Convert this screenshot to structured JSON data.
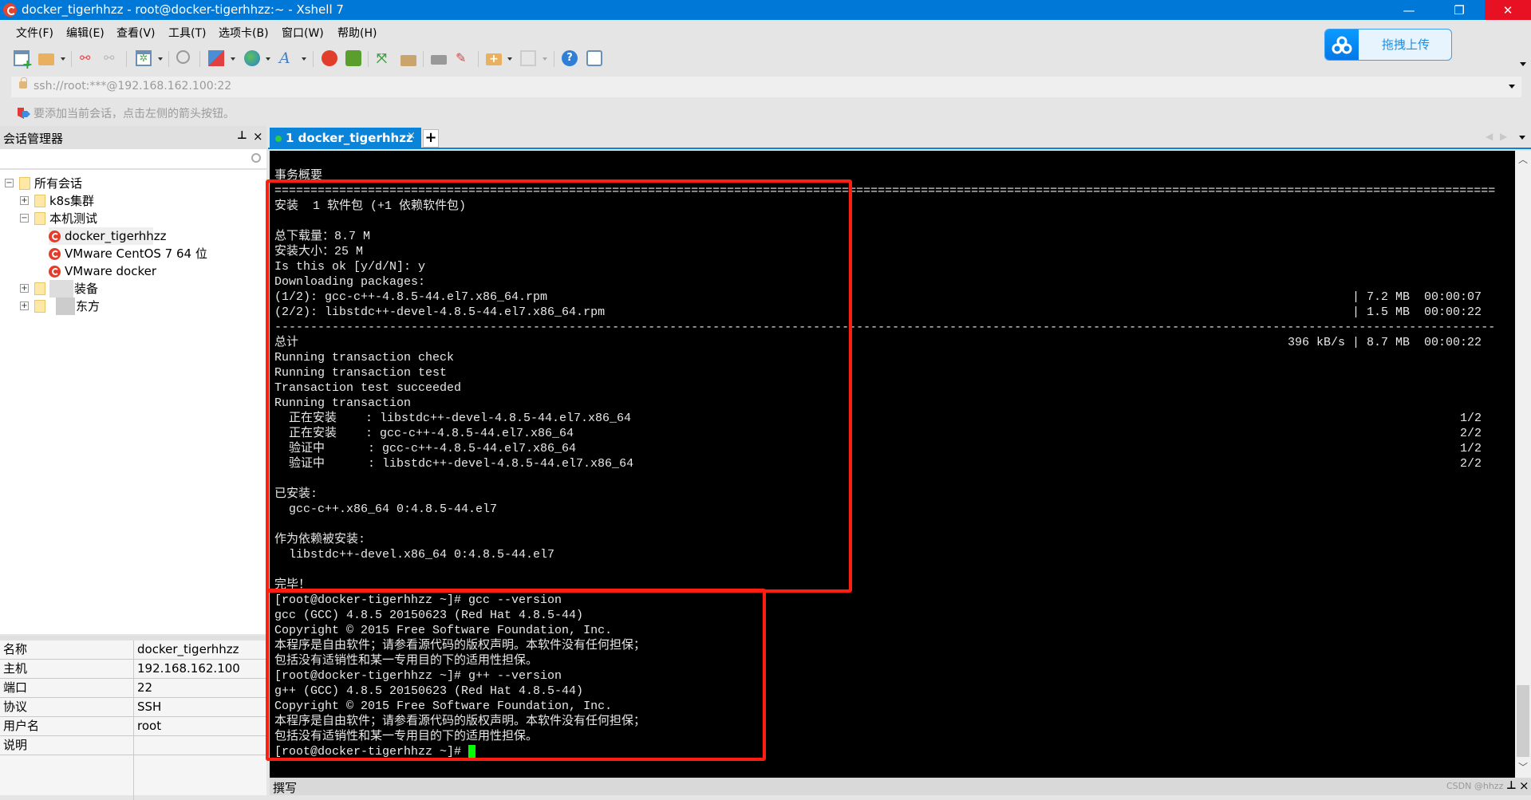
{
  "window": {
    "title": "docker_tigerhhzz - root@docker-tigerhhzz:~ - Xshell 7",
    "controls": {
      "minimize": "—",
      "restore": "❐",
      "close": "✕"
    }
  },
  "menu": [
    "文件(F)",
    "编辑(E)",
    "查看(V)",
    "工具(T)",
    "选项卡(B)",
    "窗口(W)",
    "帮助(H)"
  ],
  "toolbar": {
    "icons": [
      "new-session-icon",
      "open-folder-icon",
      "disconnect-icon",
      "reconnect-icon",
      "session-properties-icon",
      "find-icon",
      "transfer-icon",
      "globe-icon",
      "font-icon",
      "xshell-icon",
      "xftp-icon",
      "fullscreen-icon",
      "lock-icon",
      "keyboard-icon",
      "highlight-icon",
      "new-tab-group-icon",
      "layout-icon",
      "help-icon",
      "chat-icon"
    ],
    "upload_label": "拖拽上传"
  },
  "address": {
    "url": "ssh://root:***@192.168.162.100:22"
  },
  "hint": {
    "text": "要添加当前会话，点击左侧的箭头按钮。"
  },
  "session_manager": {
    "title": "会话管理器",
    "pin": "⊥",
    "close": "×",
    "search_placeholder": "",
    "tree": [
      {
        "label": "所有会话",
        "type": "root",
        "expanded": true
      },
      {
        "label": "k8s集群",
        "type": "folder",
        "expanded": false
      },
      {
        "label": "本机测试",
        "type": "folder",
        "expanded": true
      },
      {
        "label": "docker_tigerhhzz",
        "type": "session",
        "selected": true
      },
      {
        "label": "VMware CentOS 7 64 位",
        "type": "session"
      },
      {
        "label": "VMware docker",
        "type": "session"
      },
      {
        "label": "装备",
        "type": "folder",
        "expanded": false,
        "blurred_prefix": true
      },
      {
        "label": "东方",
        "type": "folder",
        "expanded": false,
        "blurred_prefix": true
      }
    ]
  },
  "properties": [
    {
      "key": "名称",
      "value": "docker_tigerhhzz"
    },
    {
      "key": "主机",
      "value": "192.168.162.100"
    },
    {
      "key": "端口",
      "value": "22"
    },
    {
      "key": "协议",
      "value": "SSH"
    },
    {
      "key": "用户名",
      "value": "root"
    },
    {
      "key": "说明",
      "value": ""
    }
  ],
  "tabs": [
    {
      "number": "1",
      "label": "1 docker_tigerhhzz",
      "active": true,
      "close": "×"
    }
  ],
  "tab_add": "+",
  "terminal": {
    "lines": [
      "事务概要",
      "==========================================================================================================================================================================",
      "安装  1 软件包 (+1 依赖软件包)",
      "",
      "总下载量：8.7 M",
      "安装大小：25 M",
      "Is this ok [y/d/N]: y",
      "Downloading packages:",
      "(1/2): gcc-c++-4.8.5-44.el7.x86_64.rpm",
      "(2/2): libstdc++-devel-4.8.5-44.el7.x86_64.rpm",
      "--------------------------------------------------------------------------------------------------------------------------------------------------------------------------",
      "总计",
      "Running transaction check",
      "Running transaction test",
      "Transaction test succeeded",
      "Running transaction",
      "  正在安装    : libstdc++-devel-4.8.5-44.el7.x86_64",
      "  正在安装    : gcc-c++-4.8.5-44.el7.x86_64",
      "  验证中      : gcc-c++-4.8.5-44.el7.x86_64",
      "  验证中      : libstdc++-devel-4.8.5-44.el7.x86_64",
      "",
      "已安装:",
      "  gcc-c++.x86_64 0:4.8.5-44.el7",
      "",
      "作为依赖被安装:",
      "  libstdc++-devel.x86_64 0:4.8.5-44.el7",
      "",
      "完毕！",
      "[root@docker-tigerhhzz ~]# gcc --version",
      "gcc (GCC) 4.8.5 20150623 (Red Hat 4.8.5-44)",
      "Copyright © 2015 Free Software Foundation, Inc.",
      "本程序是自由软件；请参看源代码的版权声明。本软件没有任何担保；",
      "包括没有适销性和某一专用目的下的适用性担保。",
      "[root@docker-tigerhhzz ~]# g++ --version",
      "g++ (GCC) 4.8.5 20150623 (Red Hat 4.8.5-44)",
      "Copyright © 2015 Free Software Foundation, Inc.",
      "本程序是自由软件；请参看源代码的版权声明。本软件没有任何担保；",
      "包括没有适销性和某一专用目的下的适用性担保。",
      "[root@docker-tigerhhzz ~]# "
    ],
    "right_columns": [
      {
        "line": 8,
        "text": "| 7.2 MB  00:00:07"
      },
      {
        "line": 9,
        "text": "| 1.5 MB  00:00:22"
      },
      {
        "line": 11,
        "text": "396 kB/s | 8.7 MB  00:00:22"
      },
      {
        "line": 16,
        "text": "1/2"
      },
      {
        "line": 17,
        "text": "2/2"
      },
      {
        "line": 18,
        "text": "1/2"
      },
      {
        "line": 19,
        "text": "2/2"
      }
    ],
    "cursor_color": "#00ff00",
    "highlight_color": "#ff1e10"
  },
  "compose": {
    "label": "撰写",
    "watermark": "CSDN @hhzz"
  }
}
